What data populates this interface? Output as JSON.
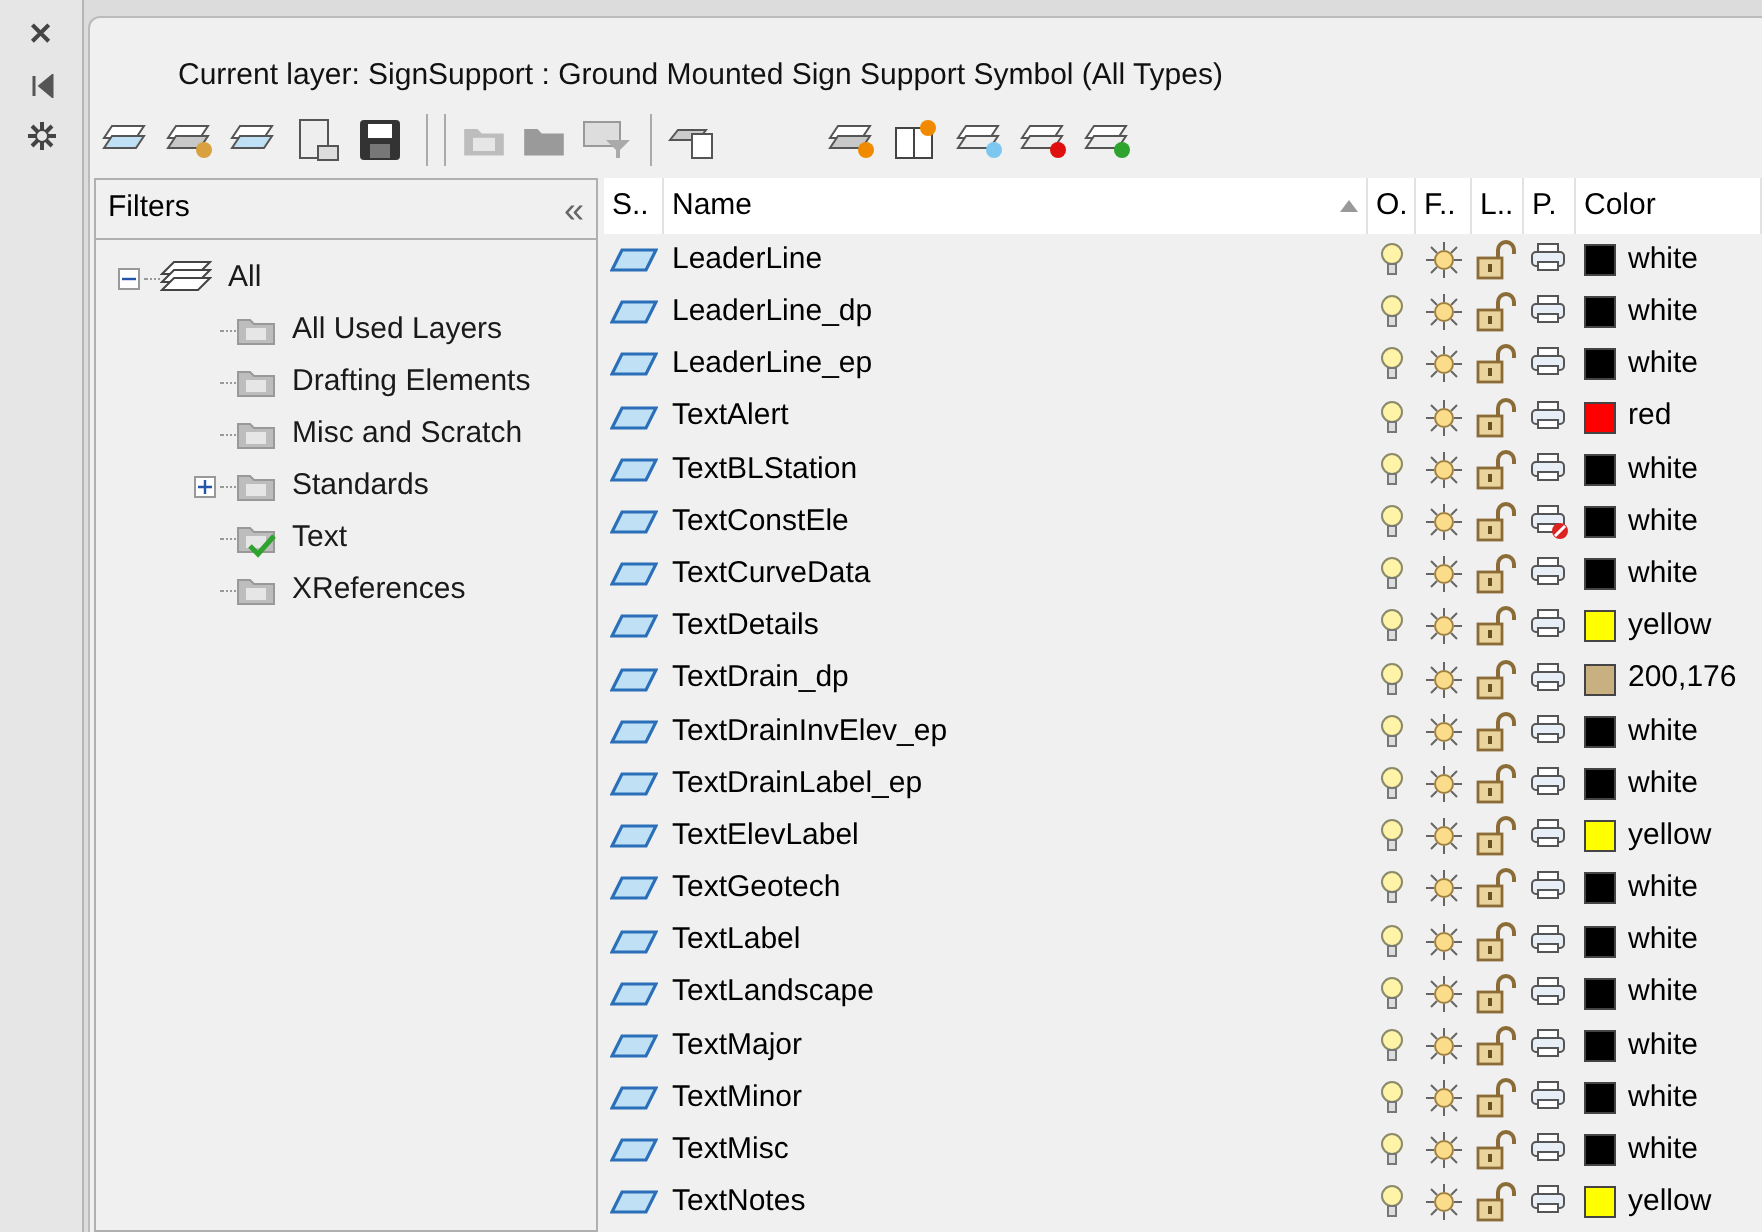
{
  "side_strip": {
    "close": "✕"
  },
  "current_layer": "Current layer: SignSupport : Ground Mounted Sign Support Symbol (All Types)",
  "filters": {
    "title": "Filters",
    "collapse": "«",
    "tree": [
      {
        "label": "All",
        "kind": "root",
        "expanded": true,
        "children": [
          {
            "label": "All Used Layers",
            "kind": "filter",
            "selected": false
          },
          {
            "label": "Drafting Elements",
            "kind": "filter",
            "selected": false
          },
          {
            "label": "Misc and Scratch",
            "kind": "filter",
            "selected": false
          },
          {
            "label": "Standards",
            "kind": "filter",
            "selected": false,
            "expanded": false
          },
          {
            "label": "Text",
            "kind": "filter",
            "selected": true
          },
          {
            "label": "XReferences",
            "kind": "filter",
            "selected": false
          }
        ]
      }
    ]
  },
  "table": {
    "columns": [
      "S..",
      "Name",
      "O.",
      "F..",
      "L..",
      "P.",
      "Color"
    ],
    "rows": [
      {
        "name": "LeaderLine",
        "plot": true,
        "color_name": "white",
        "color": "#000000"
      },
      {
        "name": "LeaderLine_dp",
        "plot": true,
        "color_name": "white",
        "color": "#000000"
      },
      {
        "name": "LeaderLine_ep",
        "plot": true,
        "color_name": "white",
        "color": "#000000"
      },
      {
        "name": "TextAlert",
        "plot": true,
        "color_name": "red",
        "color": "#ff0000"
      },
      {
        "name": "TextBLStation",
        "plot": true,
        "color_name": "white",
        "color": "#000000"
      },
      {
        "name": "TextConstEle",
        "plot": false,
        "color_name": "white",
        "color": "#000000"
      },
      {
        "name": "TextCurveData",
        "plot": true,
        "color_name": "white",
        "color": "#000000"
      },
      {
        "name": "TextDetails",
        "plot": true,
        "color_name": "yellow",
        "color": "#ffff00"
      },
      {
        "name": "TextDrain_dp",
        "plot": true,
        "color_name": "200,176",
        "color": "#c8b080"
      },
      {
        "name": "TextDrainInvElev_ep",
        "plot": true,
        "color_name": "white",
        "color": "#000000"
      },
      {
        "name": "TextDrainLabel_ep",
        "plot": true,
        "color_name": "white",
        "color": "#000000"
      },
      {
        "name": "TextElevLabel",
        "plot": true,
        "color_name": "yellow",
        "color": "#ffff00"
      },
      {
        "name": "TextGeotech",
        "plot": true,
        "color_name": "white",
        "color": "#000000"
      },
      {
        "name": "TextLabel",
        "plot": true,
        "color_name": "white",
        "color": "#000000"
      },
      {
        "name": "TextLandscape",
        "plot": true,
        "color_name": "white",
        "color": "#000000"
      },
      {
        "name": "TextMajor",
        "plot": true,
        "color_name": "white",
        "color": "#000000"
      },
      {
        "name": "TextMinor",
        "plot": true,
        "color_name": "white",
        "color": "#000000"
      },
      {
        "name": "TextMisc",
        "plot": true,
        "color_name": "white",
        "color": "#000000"
      },
      {
        "name": "TextNotes",
        "plot": true,
        "color_name": "yellow",
        "color": "#ffff00"
      }
    ]
  }
}
